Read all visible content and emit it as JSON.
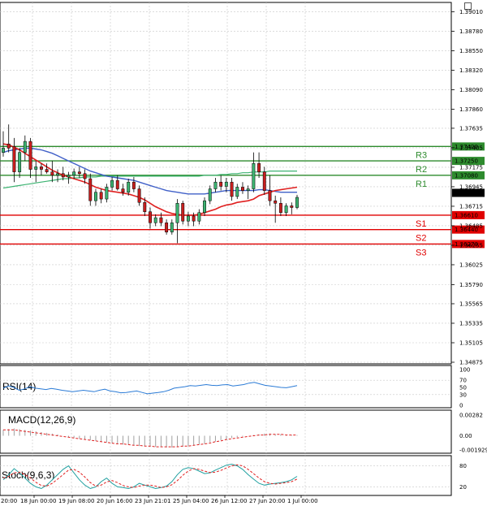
{
  "chart_data": {
    "type": "candlestick",
    "title": "",
    "price_axis": {
      "ylim": [
        1.34875,
        1.391
      ],
      "ticks": [
        "1.39010",
        "1.38780",
        "1.38550",
        "1.38320",
        "1.38090",
        "1.37860",
        "1.37635",
        "1.37405",
        "1.37175",
        "1.36945",
        "1.36715",
        "1.36485",
        "1.36255",
        "1.36025",
        "1.35790",
        "1.35565",
        "1.35335",
        "1.35105",
        "1.34875"
      ]
    },
    "x_tick_labels": [
      "18 Jun 00:00",
      "19 Jun 08:00",
      "20 Jun 16:00",
      "23 Jun 21:01",
      "25 Jun 04:00",
      "26 Jun 12:00",
      "27 Jun 20:00",
      "1 Jul 00:00"
    ],
    "x_left_partial_label": "20:00",
    "current_price": "1.36873",
    "levels": [
      {
        "name": "R3",
        "value": 1.3742,
        "label": "1.37420",
        "color": "#2e8b2e"
      },
      {
        "name": "R2",
        "value": 1.3725,
        "label": "1.37250",
        "color": "#2e8b2e"
      },
      {
        "name": "R1",
        "value": 1.3708,
        "label": "1.37080",
        "color": "#2e8b2e"
      },
      {
        "name": "S1",
        "value": 1.3661,
        "label": "1.36610",
        "color": "#e00000"
      },
      {
        "name": "S2",
        "value": 1.3644,
        "label": "1.36440",
        "color": "#e00000"
      },
      {
        "name": "S3",
        "value": 1.3627,
        "label": "1.36270",
        "color": "#e00000"
      }
    ],
    "candles": [
      {
        "o": 1.3735,
        "h": 1.376,
        "l": 1.373,
        "c": 1.374
      },
      {
        "o": 1.3745,
        "h": 1.3768,
        "l": 1.3735,
        "c": 1.374
      },
      {
        "o": 1.3742,
        "h": 1.3752,
        "l": 1.37,
        "c": 1.3712
      },
      {
        "o": 1.3712,
        "h": 1.374,
        "l": 1.3705,
        "c": 1.3735
      },
      {
        "o": 1.3735,
        "h": 1.3755,
        "l": 1.3725,
        "c": 1.3748
      },
      {
        "o": 1.3748,
        "h": 1.3752,
        "l": 1.3705,
        "c": 1.3715
      },
      {
        "o": 1.3715,
        "h": 1.3725,
        "l": 1.37,
        "c": 1.3718
      },
      {
        "o": 1.3718,
        "h": 1.3722,
        "l": 1.3708,
        "c": 1.3715
      },
      {
        "o": 1.3715,
        "h": 1.3722,
        "l": 1.371,
        "c": 1.3712
      },
      {
        "o": 1.3712,
        "h": 1.3725,
        "l": 1.37,
        "c": 1.3708
      },
      {
        "o": 1.3708,
        "h": 1.3715,
        "l": 1.37,
        "c": 1.371
      },
      {
        "o": 1.371,
        "h": 1.3718,
        "l": 1.3702,
        "c": 1.3706
      },
      {
        "o": 1.3706,
        "h": 1.3712,
        "l": 1.3698,
        "c": 1.3708
      },
      {
        "o": 1.3708,
        "h": 1.3716,
        "l": 1.3704,
        "c": 1.3712
      },
      {
        "o": 1.3712,
        "h": 1.3718,
        "l": 1.3705,
        "c": 1.371
      },
      {
        "o": 1.371,
        "h": 1.3715,
        "l": 1.3698,
        "c": 1.3704
      },
      {
        "o": 1.3704,
        "h": 1.371,
        "l": 1.3672,
        "c": 1.3678
      },
      {
        "o": 1.3678,
        "h": 1.3692,
        "l": 1.3672,
        "c": 1.3688
      },
      {
        "o": 1.3688,
        "h": 1.3692,
        "l": 1.3675,
        "c": 1.368
      },
      {
        "o": 1.368,
        "h": 1.3698,
        "l": 1.3676,
        "c": 1.3694
      },
      {
        "o": 1.3694,
        "h": 1.3706,
        "l": 1.369,
        "c": 1.3702
      },
      {
        "o": 1.3702,
        "h": 1.3708,
        "l": 1.369,
        "c": 1.3692
      },
      {
        "o": 1.3692,
        "h": 1.3698,
        "l": 1.3684,
        "c": 1.3688
      },
      {
        "o": 1.3688,
        "h": 1.3704,
        "l": 1.3684,
        "c": 1.37
      },
      {
        "o": 1.37,
        "h": 1.3706,
        "l": 1.3688,
        "c": 1.3692
      },
      {
        "o": 1.3692,
        "h": 1.3696,
        "l": 1.3672,
        "c": 1.3676
      },
      {
        "o": 1.3676,
        "h": 1.3682,
        "l": 1.366,
        "c": 1.3665
      },
      {
        "o": 1.3665,
        "h": 1.367,
        "l": 1.3645,
        "c": 1.3652
      },
      {
        "o": 1.3652,
        "h": 1.3662,
        "l": 1.3648,
        "c": 1.3658
      },
      {
        "o": 1.3658,
        "h": 1.3664,
        "l": 1.3648,
        "c": 1.3652
      },
      {
        "o": 1.3652,
        "h": 1.3656,
        "l": 1.3638,
        "c": 1.3641
      },
      {
        "o": 1.3641,
        "h": 1.3656,
        "l": 1.3638,
        "c": 1.3652
      },
      {
        "o": 1.3652,
        "h": 1.368,
        "l": 1.3628,
        "c": 1.3675
      },
      {
        "o": 1.3675,
        "h": 1.3678,
        "l": 1.365,
        "c": 1.3654
      },
      {
        "o": 1.3654,
        "h": 1.3665,
        "l": 1.3648,
        "c": 1.366
      },
      {
        "o": 1.366,
        "h": 1.3664,
        "l": 1.3648,
        "c": 1.3654
      },
      {
        "o": 1.3654,
        "h": 1.3668,
        "l": 1.365,
        "c": 1.3664
      },
      {
        "o": 1.3664,
        "h": 1.3682,
        "l": 1.366,
        "c": 1.3678
      },
      {
        "o": 1.3678,
        "h": 1.3696,
        "l": 1.3674,
        "c": 1.3692
      },
      {
        "o": 1.3692,
        "h": 1.3705,
        "l": 1.3688,
        "c": 1.37
      },
      {
        "o": 1.37,
        "h": 1.3708,
        "l": 1.369,
        "c": 1.3695
      },
      {
        "o": 1.3695,
        "h": 1.3705,
        "l": 1.3688,
        "c": 1.37
      },
      {
        "o": 1.37,
        "h": 1.3705,
        "l": 1.3678,
        "c": 1.3683
      },
      {
        "o": 1.3683,
        "h": 1.3698,
        "l": 1.368,
        "c": 1.3694
      },
      {
        "o": 1.3694,
        "h": 1.37,
        "l": 1.3686,
        "c": 1.369
      },
      {
        "o": 1.369,
        "h": 1.3696,
        "l": 1.368,
        "c": 1.3692
      },
      {
        "o": 1.3692,
        "h": 1.3735,
        "l": 1.3688,
        "c": 1.3722
      },
      {
        "o": 1.3722,
        "h": 1.3735,
        "l": 1.3705,
        "c": 1.3712
      },
      {
        "o": 1.3712,
        "h": 1.3718,
        "l": 1.3685,
        "c": 1.369
      },
      {
        "o": 1.369,
        "h": 1.3708,
        "l": 1.3672,
        "c": 1.3678
      },
      {
        "o": 1.3678,
        "h": 1.3684,
        "l": 1.3652,
        "c": 1.3675
      },
      {
        "o": 1.3675,
        "h": 1.3682,
        "l": 1.366,
        "c": 1.3664
      },
      {
        "o": 1.3664,
        "h": 1.3675,
        "l": 1.366,
        "c": 1.3672
      },
      {
        "o": 1.3672,
        "h": 1.3676,
        "l": 1.3662,
        "c": 1.367
      },
      {
        "o": 1.367,
        "h": 1.3685,
        "l": 1.3668,
        "c": 1.3682
      }
    ],
    "ma_red": [
      1.3745,
      1.3744,
      1.3741,
      1.3738,
      1.3734,
      1.373,
      1.3726,
      1.3722,
      1.3718,
      1.3714,
      1.3711,
      1.3708,
      1.3706,
      1.3704,
      1.3702,
      1.37,
      1.3697,
      1.3694,
      1.3692,
      1.369,
      1.3689,
      1.3688,
      1.3687,
      1.3686,
      1.3684,
      1.3682,
      1.3679,
      1.3675,
      1.3671,
      1.3668,
      1.3665,
      1.3663,
      1.3662,
      1.3661,
      1.3661,
      1.3661,
      1.3662,
      1.3664,
      1.3666,
      1.3668,
      1.3671,
      1.3673,
      1.3674,
      1.3676,
      1.3677,
      1.3678,
      1.368,
      1.3684,
      1.3686,
      1.3688,
      1.369,
      1.3691,
      1.3692,
      1.3693,
      1.3694
    ],
    "ma_blue": [
      1.3735,
      1.3737,
      1.3738,
      1.3739,
      1.374,
      1.374,
      1.3739,
      1.3738,
      1.3736,
      1.3734,
      1.3731,
      1.3728,
      1.3725,
      1.3722,
      1.3719,
      1.3716,
      1.3713,
      1.3711,
      1.3709,
      1.3707,
      1.3706,
      1.3705,
      1.3704,
      1.3703,
      1.3702,
      1.37,
      1.3698,
      1.3696,
      1.3694,
      1.3692,
      1.369,
      1.3689,
      1.3688,
      1.3687,
      1.3686,
      1.3686,
      1.3686,
      1.3686,
      1.3687,
      1.3688,
      1.3689,
      1.369,
      1.369,
      1.369,
      1.369,
      1.369,
      1.369,
      1.3691,
      1.3691,
      1.369,
      1.3689,
      1.3688,
      1.3688,
      1.3688,
      1.3688
    ],
    "ma_green": [
      1.3693,
      1.3694,
      1.3695,
      1.3696,
      1.3697,
      1.3698,
      1.3699,
      1.37,
      1.3701,
      1.3702,
      1.3703,
      1.3704,
      1.3704,
      1.3705,
      1.3705,
      1.3706,
      1.3706,
      1.3706,
      1.3707,
      1.3707,
      1.3707,
      1.3707,
      1.3707,
      1.3707,
      1.3707,
      1.3707,
      1.3707,
      1.3707,
      1.3707,
      1.3707,
      1.3707,
      1.3707,
      1.3707,
      1.3707,
      1.3707,
      1.3707,
      1.3707,
      1.3708,
      1.3708,
      1.3708,
      1.3709,
      1.3709,
      1.371,
      1.371,
      1.3711,
      1.3711,
      1.3712,
      1.3712,
      1.3712,
      1.3713,
      1.3713,
      1.3713,
      1.3713,
      1.3713,
      1.3713
    ],
    "rsi": {
      "label": "RSI(14)",
      "ticks": [
        "100",
        "70",
        "50",
        "30",
        "0"
      ],
      "values": [
        48,
        54,
        50,
        42,
        46,
        52,
        48,
        46,
        44,
        47,
        45,
        42,
        40,
        38,
        40,
        42,
        40,
        38,
        42,
        45,
        40,
        38,
        35,
        36,
        38,
        40,
        36,
        32,
        34,
        36,
        38,
        42,
        48,
        50,
        52,
        55,
        54,
        56,
        58,
        56,
        55,
        57,
        58,
        54,
        56,
        58,
        62,
        64,
        60,
        56,
        54,
        52,
        50,
        49,
        52,
        55
      ]
    },
    "macd": {
      "label": "MACD(12,26,9)",
      "ticks": [
        "0.00282",
        "0.00",
        "-0.001929"
      ],
      "hist": [
        0.0008,
        0.0009,
        0.001,
        0.0009,
        0.0008,
        0.0007,
        0.0006,
        0.0005,
        0.0004,
        0.0003,
        0.0002,
        0.0,
        -0.0002,
        -0.0003,
        -0.0004,
        -0.0005,
        -0.0006,
        -0.0007,
        -0.0008,
        -0.0009,
        -0.001,
        -0.0011,
        -0.0012,
        -0.0012,
        -0.0013,
        -0.0014,
        -0.0014,
        -0.0015,
        -0.0015,
        -0.0015,
        -0.0016,
        -0.0016,
        -0.0015,
        -0.0015,
        -0.0014,
        -0.0013,
        -0.0012,
        -0.0011,
        -0.0009,
        -0.0008,
        -0.0006,
        -0.0005,
        -0.0003,
        -0.0002,
        -0.0001,
        0.0,
        0.0001,
        0.0002,
        0.0003,
        0.0003,
        0.0002,
        0.0002,
        0.0001,
        0.0001,
        0.0001
      ],
      "signal": [
        0.0008,
        0.0008,
        0.0008,
        0.0007,
        0.0006,
        0.0005,
        0.0004,
        0.0003,
        0.0002,
        0.0001,
        0.0,
        -0.0001,
        -0.0002,
        -0.0003,
        -0.0004,
        -0.0005,
        -0.0006,
        -0.0007,
        -0.0008,
        -0.0009,
        -0.001,
        -0.0011,
        -0.0011,
        -0.0012,
        -0.0013,
        -0.0013,
        -0.0014,
        -0.0014,
        -0.0015,
        -0.0015,
        -0.0015,
        -0.0015,
        -0.0015,
        -0.0014,
        -0.0014,
        -0.0013,
        -0.0012,
        -0.0011,
        -0.001,
        -0.0008,
        -0.0007,
        -0.0005,
        -0.0004,
        -0.0003,
        -0.0002,
        -0.0001,
        0.0,
        0.0001,
        0.0001,
        0.0002,
        0.0002,
        0.0002,
        0.0001,
        0.0001,
        0.0001
      ]
    },
    "stoch": {
      "label": "Stoch(9,6,3)",
      "ticks": [
        "80",
        "20"
      ],
      "k": [
        40,
        55,
        72,
        60,
        45,
        30,
        20,
        15,
        25,
        40,
        55,
        70,
        80,
        60,
        40,
        25,
        15,
        20,
        35,
        45,
        30,
        20,
        18,
        15,
        20,
        30,
        25,
        20,
        15,
        18,
        22,
        35,
        55,
        70,
        75,
        72,
        65,
        58,
        60,
        68,
        75,
        82,
        85,
        80,
        70,
        55,
        42,
        30,
        25,
        28,
        30,
        32,
        35,
        40,
        50
      ],
      "d": [
        45,
        50,
        60,
        62,
        55,
        45,
        33,
        24,
        22,
        30,
        42,
        55,
        68,
        70,
        62,
        48,
        32,
        22,
        25,
        34,
        38,
        32,
        24,
        20,
        18,
        22,
        25,
        25,
        22,
        18,
        20,
        26,
        38,
        53,
        65,
        72,
        70,
        65,
        61,
        62,
        67,
        74,
        80,
        83,
        80,
        70,
        58,
        45,
        35,
        30,
        28,
        30,
        32,
        35,
        42
      ]
    }
  }
}
